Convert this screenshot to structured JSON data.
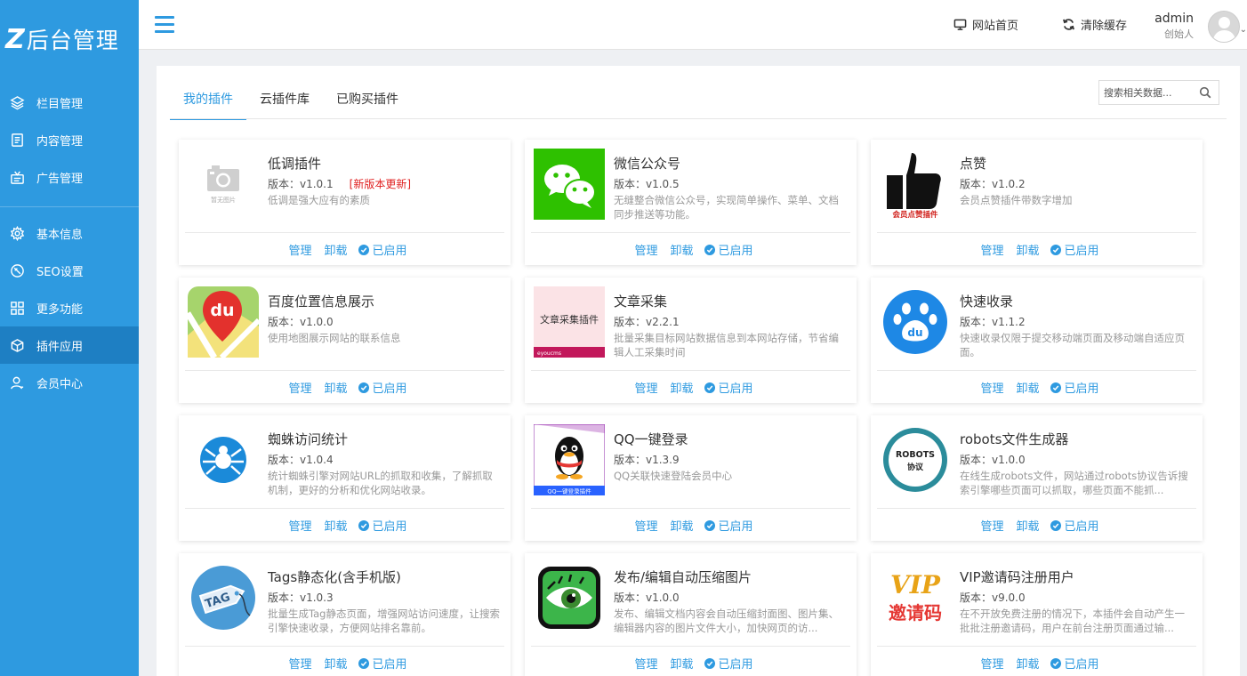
{
  "sidebar": {
    "logo_mark": "Z",
    "logo_text": "后台管理",
    "items": [
      {
        "label": "栏目管理",
        "icon": "layers-icon"
      },
      {
        "label": "内容管理",
        "icon": "document-icon"
      },
      {
        "label": "广告管理",
        "icon": "ad-icon"
      },
      {
        "label": "基本信息",
        "icon": "gear-icon"
      },
      {
        "label": "SEO设置",
        "icon": "compass-icon"
      },
      {
        "label": "更多功能",
        "icon": "grid-icon"
      },
      {
        "label": "插件应用",
        "icon": "cube-icon",
        "active": true
      },
      {
        "label": "会员中心",
        "icon": "user-icon"
      }
    ]
  },
  "header": {
    "home_label": "网站首页",
    "clear_cache_label": "清除缓存",
    "user_name": "admin",
    "user_role": "创始人"
  },
  "tabs": [
    {
      "label": "我的插件",
      "active": true
    },
    {
      "label": "云插件库"
    },
    {
      "label": "已购买插件"
    }
  ],
  "search": {
    "placeholder": "搜索相关数据..."
  },
  "actions": {
    "manage": "管理",
    "uninstall": "卸载",
    "enabled": "已启用"
  },
  "plugins": [
    {
      "title": "低调插件",
      "version": "版本：v1.0.1",
      "update": "[新版本更新]",
      "desc": "低调是强大应有的素质",
      "thumb_text": "暂无图片"
    },
    {
      "title": "微信公众号",
      "version": "版本：v1.0.5",
      "desc": "无缝整合微信公众号，实现简单操作、菜单、文档同步推送等功能。"
    },
    {
      "title": "点赞",
      "version": "版本：v1.0.2",
      "desc": "会员点赞插件带数字增加",
      "thumb_text": "会员点赞插件"
    },
    {
      "title": "百度位置信息展示",
      "version": "版本：v1.0.0",
      "desc": "使用地图展示网站的联系信息",
      "thumb_text": "du"
    },
    {
      "title": "文章采集",
      "version": "版本：v2.2.1",
      "desc": "批量采集目标网站数据信息到本网站存储，节省编辑人工采集时间",
      "thumb_text": "文章采集插件",
      "thumb_sub": "eyoucms"
    },
    {
      "title": "快速收录",
      "version": "版本：v1.1.2",
      "desc": "快速收录仅限于提交移动端页面及移动端自适应页面。",
      "thumb_text": "du"
    },
    {
      "title": "蜘蛛访问统计",
      "version": "版本：v1.0.4",
      "desc": "统计蜘蛛引擎对网站URL的抓取和收集，了解抓取机制，更好的分析和优化网站收录。"
    },
    {
      "title": "QQ一键登录",
      "version": "版本：v1.3.9",
      "desc": "QQ关联快速登陆会员中心",
      "thumb_text": "QQ一键登录插件"
    },
    {
      "title": "robots文件生成器",
      "version": "版本：v1.0.0",
      "desc": "在线生成robots文件，网站通过robots协议告诉搜索引擎哪些页面可以抓取，哪些页面不能抓...",
      "thumb_text": "ROBOTS",
      "thumb_sub": "协议"
    },
    {
      "title": "Tags静态化(含手机版)",
      "version": "版本：v1.0.3",
      "desc": "批量生成Tag静态页面，增强网站访问速度，让搜索引擎快速收录，方便网站排名靠前。",
      "thumb_text": "TAG"
    },
    {
      "title": "发布/编辑自动压缩图片",
      "version": "版本：v1.0.0",
      "desc": "发布、编辑文档内容会自动压缩封面图、图片集、编辑器内容的图片文件大小，加快网页的访..."
    },
    {
      "title": "VIP邀请码注册用户",
      "version": "版本：v9.0.0",
      "desc": "在不开放免费注册的情况下，本插件会自动产生一批批注册邀请码，用户在前台注册页面通过输...",
      "thumb_text": "VIP",
      "thumb_sub": "邀请码"
    }
  ],
  "colors": {
    "accent": "#2e9ae0",
    "sidebar_active": "#1e7fc3",
    "update_red": "#e02020"
  }
}
